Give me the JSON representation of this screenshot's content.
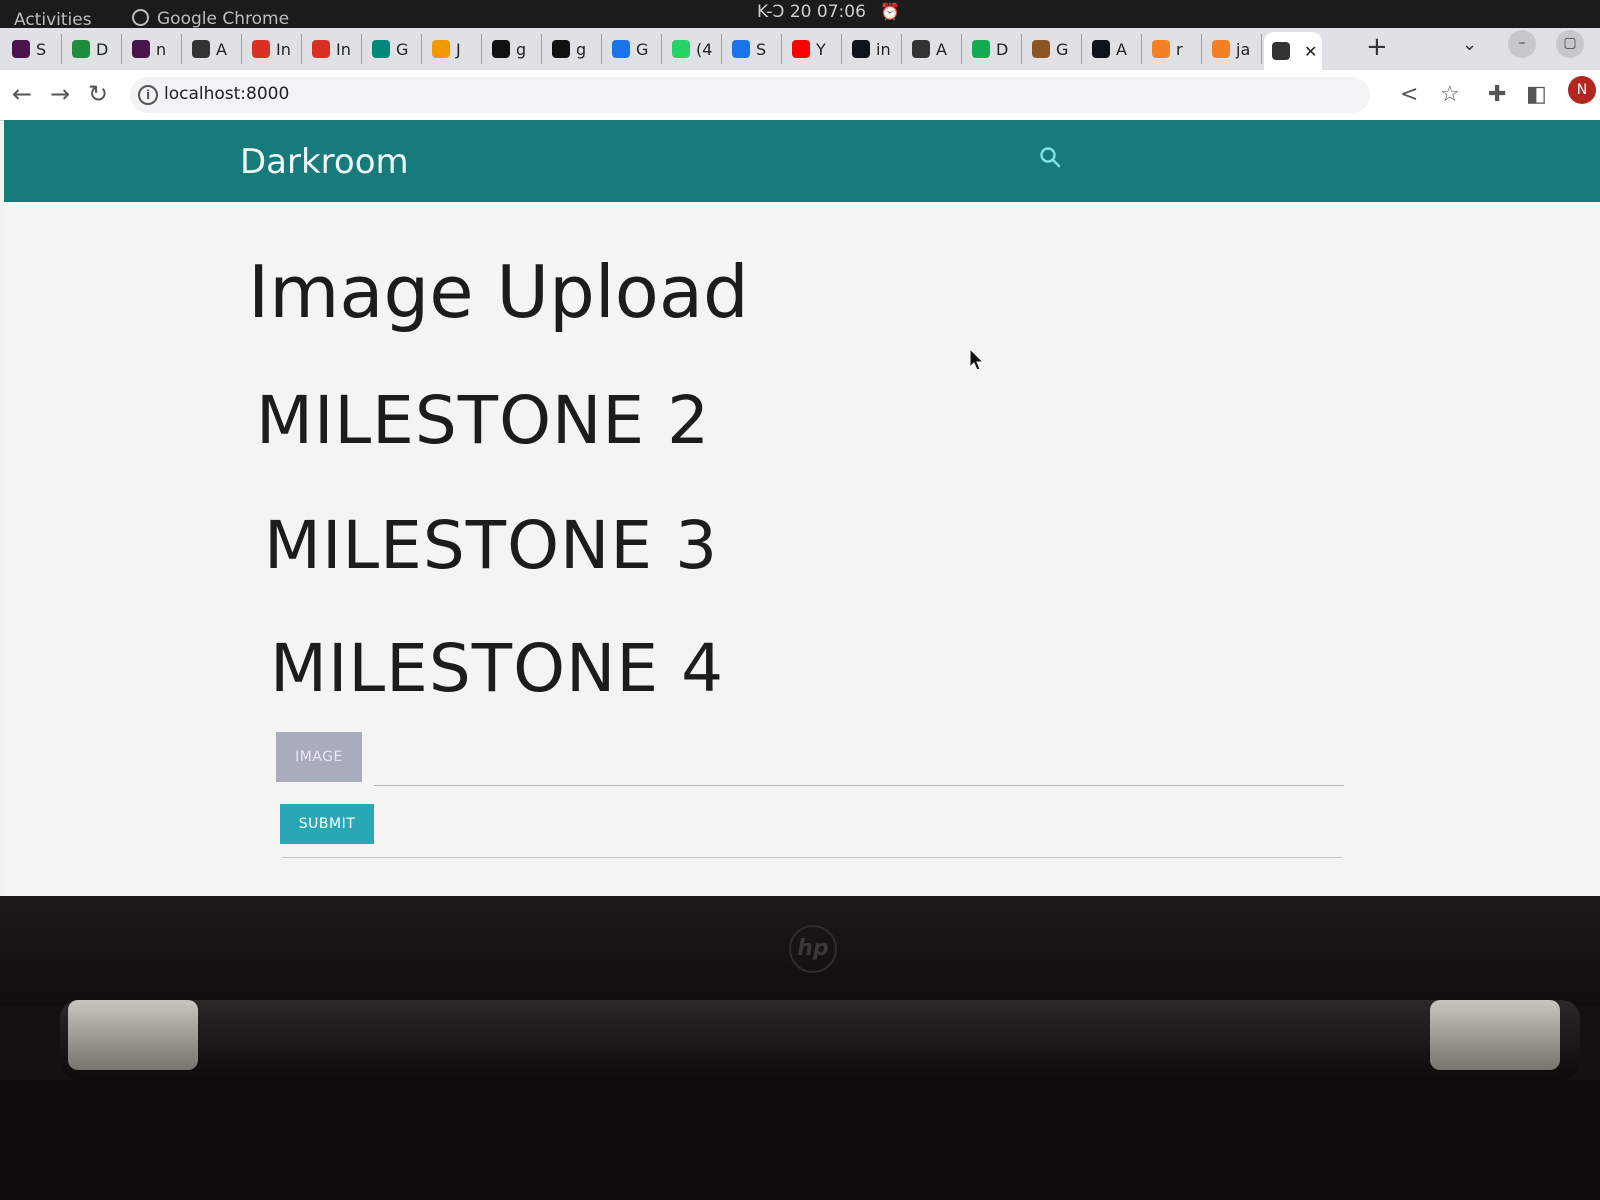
{
  "os": {
    "activities": "Activities",
    "app_name": "Google Chrome",
    "clock": "K-Ͻ 20  07:06"
  },
  "tabs": [
    {
      "label": "S",
      "icon": "slack-icon",
      "color": "#4a154b"
    },
    {
      "label": "D",
      "icon": "google-drive-icon",
      "color": "#1e8e3e"
    },
    {
      "label": "n",
      "icon": "slack-icon",
      "color": "#4a154b"
    },
    {
      "label": "A",
      "icon": "globe-icon",
      "color": "#333333"
    },
    {
      "label": "In",
      "icon": "gmail-icon",
      "color": "#d93025"
    },
    {
      "label": "In",
      "icon": "gmail-icon",
      "color": "#d93025"
    },
    {
      "label": "G",
      "icon": "google-meet-icon",
      "color": "#00897b"
    },
    {
      "label": "J",
      "icon": "slides-icon",
      "color": "#f29900"
    },
    {
      "label": "g",
      "icon": "github-icon",
      "color": "#111111"
    },
    {
      "label": "g",
      "icon": "github-icon",
      "color": "#111111"
    },
    {
      "label": "G",
      "icon": "calendar-icon",
      "color": "#1a73e8"
    },
    {
      "label": "(4",
      "icon": "whatsapp-icon",
      "color": "#25d366"
    },
    {
      "label": "S",
      "icon": "settings-icon",
      "color": "#1a73e8"
    },
    {
      "label": "Y",
      "icon": "youtube-icon",
      "color": "#ff0000"
    },
    {
      "label": "in",
      "icon": "hackerrank-icon",
      "color": "#0e141e"
    },
    {
      "label": "A",
      "icon": "globe-icon",
      "color": "#333333"
    },
    {
      "label": "D",
      "icon": "mongodb-icon",
      "color": "#13aa52"
    },
    {
      "label": "G",
      "icon": "avatar-icon",
      "color": "#8d5524"
    },
    {
      "label": "A",
      "icon": "hackerrank-icon",
      "color": "#0e141e"
    },
    {
      "label": "r",
      "icon": "stackoverflow-icon",
      "color": "#f48024"
    },
    {
      "label": "ja",
      "icon": "stackoverflow-icon",
      "color": "#f48024"
    },
    {
      "label": "",
      "icon": "globe-icon",
      "color": "#333333",
      "active": true
    }
  ],
  "address_bar": {
    "url": "localhost:8000"
  },
  "site": {
    "brand": "Darkroom",
    "title": "Image Upload",
    "milestones": [
      "MILESTONE 2",
      "MILESTONE 3",
      "MILESTONE 4"
    ],
    "file_button": "IMAGE",
    "submit_button": "SUBMIT"
  },
  "profile_initial": "N",
  "colors": {
    "navbar": "#177a7b",
    "submit": "#2aa7b5",
    "file_button": "#a9acbd"
  }
}
